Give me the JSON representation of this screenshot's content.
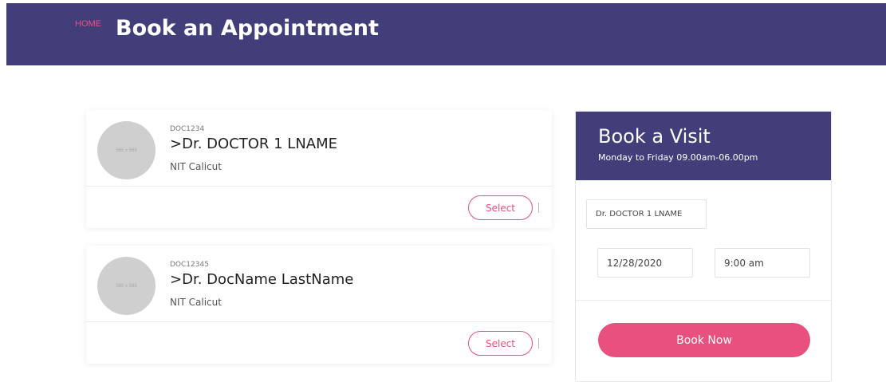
{
  "header": {
    "home_label": "HOME",
    "title": "Book an Appointment"
  },
  "doctors": [
    {
      "code": "DOC1234",
      "name": ">Dr. DOCTOR 1 LNAME",
      "institution": "NIT Calicut",
      "avatar_placeholder": "565 x 565",
      "select_label": "Select"
    },
    {
      "code": "DOC12345",
      "name": ">Dr. DocName LastName",
      "institution": "NIT Calicut",
      "avatar_placeholder": "565 x 565",
      "select_label": "Select"
    }
  ],
  "booking": {
    "title": "Book a Visit",
    "hours": "Monday to Friday 09.00am-06.00pm",
    "doctor_value": "Dr. DOCTOR 1 LNAME",
    "date_value": "12/28/2020",
    "time_value": "9:00 am",
    "book_label": "Book Now"
  },
  "colors": {
    "header_bg": "#423e7a",
    "accent": "#e8507d"
  }
}
